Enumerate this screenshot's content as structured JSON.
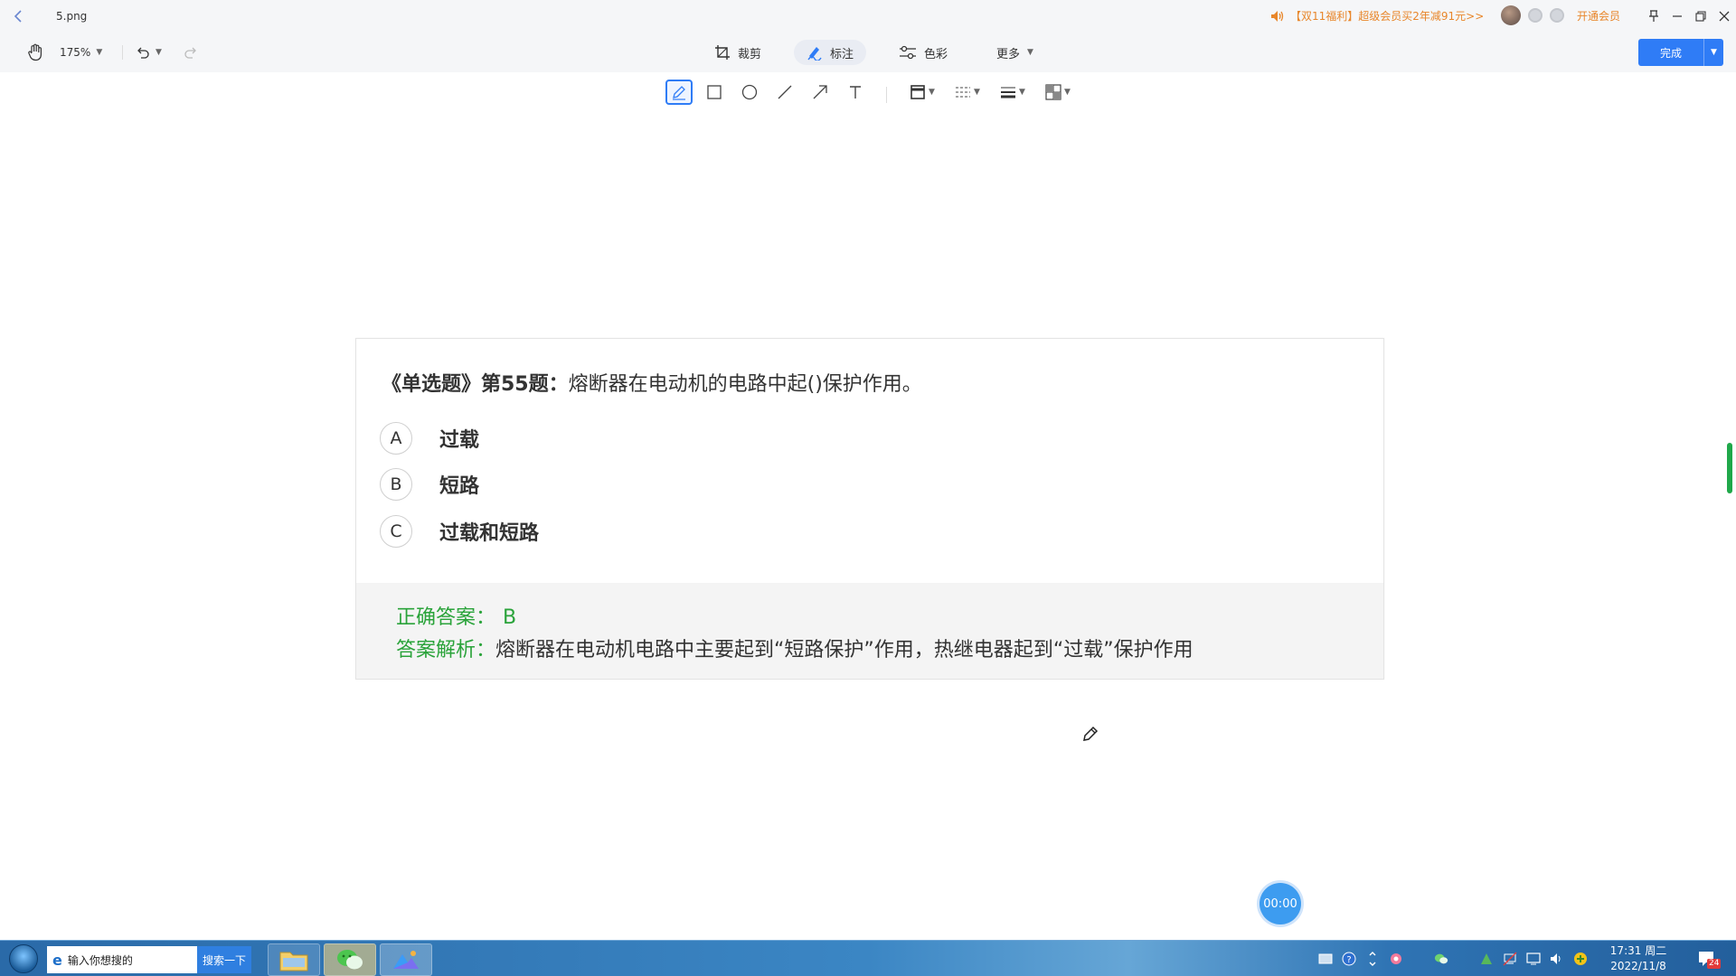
{
  "titlebar": {
    "filename": "5.png",
    "promo": "【双11福利】超级会员买2年减91元>>",
    "vip_link": "开通会员"
  },
  "toolbar": {
    "zoom": "175%",
    "crop_label": "裁剪",
    "annotate_label": "标注",
    "color_label": "色彩",
    "more_label": "更多",
    "done_label": "完成"
  },
  "annotation_tools": [
    "pencil",
    "rectangle",
    "ellipse",
    "line",
    "arrow",
    "text",
    "border-style",
    "line-spacing",
    "line-weight",
    "mosaic"
  ],
  "document": {
    "question_prefix": "《单选题》第55题：",
    "question_text": "熔断器在电动机的电路中起()保护作用。",
    "options": [
      {
        "letter": "A",
        "text": "过载"
      },
      {
        "letter": "B",
        "text": "短路"
      },
      {
        "letter": "C",
        "text": "过载和短路"
      }
    ],
    "correct_label": "正确答案：",
    "correct_value": "B",
    "explain_label": "答案解析：",
    "explain_text": "熔断器在电动机电路中主要起到“短路保护”作用，热继电器起到“过载”保护作用"
  },
  "timer": "00:00",
  "taskbar": {
    "search_placeholder": "输入你想搜的",
    "search_button": "搜索一下",
    "time": "17:31 周二",
    "date": "2022/11/8",
    "notif_count": "24"
  },
  "colors": {
    "accent": "#2f7cf6",
    "promo": "#e8862a",
    "answer_green": "#2aa33a",
    "scroll_thumb": "#20a84a"
  }
}
